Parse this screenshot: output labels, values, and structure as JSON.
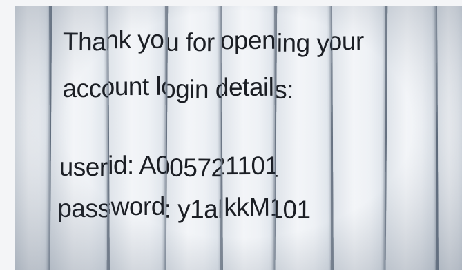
{
  "document": {
    "line1": "Thank you for opening your",
    "line2": "account login details:",
    "userid_line": "userid: A005721101",
    "password_line": "password: y1alkkM101"
  }
}
